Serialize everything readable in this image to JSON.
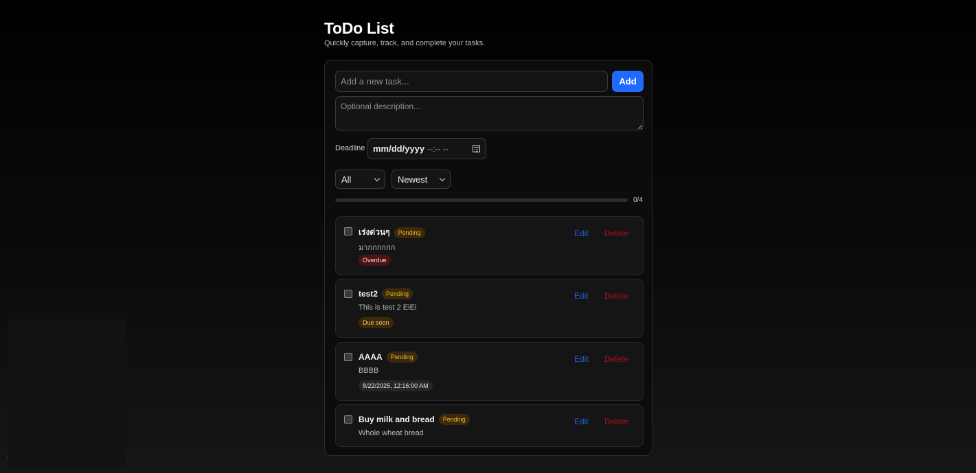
{
  "app": {
    "title": "ToDo List",
    "subtitle": "Quickly capture, track, and complete your tasks."
  },
  "form": {
    "task_placeholder": "Add a new task...",
    "add_label": "Add",
    "description_placeholder": "Optional description...",
    "deadline_label": "Deadline",
    "deadline_date_placeholder": "mm/dd/yyyy",
    "deadline_time_placeholder": "--:-- --"
  },
  "filters": {
    "status_selected": "All",
    "sort_selected": "Newest"
  },
  "progress": {
    "text": "0/4",
    "completed": 0,
    "total": 4
  },
  "tasks": [
    {
      "title": "เร่งด่วนๆ",
      "status": "Pending",
      "description": "มากกกกกก",
      "chip": "Overdue",
      "edit_label": "Edit",
      "delete_label": "Delete"
    },
    {
      "title": "test2",
      "status": "Pending",
      "description": "This is test 2 EiEi",
      "chip": "Due soon",
      "edit_label": "Edit",
      "delete_label": "Delete"
    },
    {
      "title": "AAAA",
      "status": "Pending",
      "description": "BBBB",
      "chip": "8/22/2025, 12:16:00 AM",
      "edit_label": "Edit",
      "delete_label": "Delete"
    },
    {
      "title": "Buy milk and bread",
      "status": "Pending",
      "description": "Whole wheat bread",
      "edit_label": "Edit",
      "delete_label": "Delete"
    }
  ],
  "colors": {
    "accent": "#1f6bff",
    "pending": "#f0b429",
    "overdue_bg": "#4a1414",
    "edit": "#1f5fd6",
    "delete": "#b00d13"
  },
  "icons": {
    "deadline": "calendar-icon",
    "select": "chevron-down-icon"
  }
}
